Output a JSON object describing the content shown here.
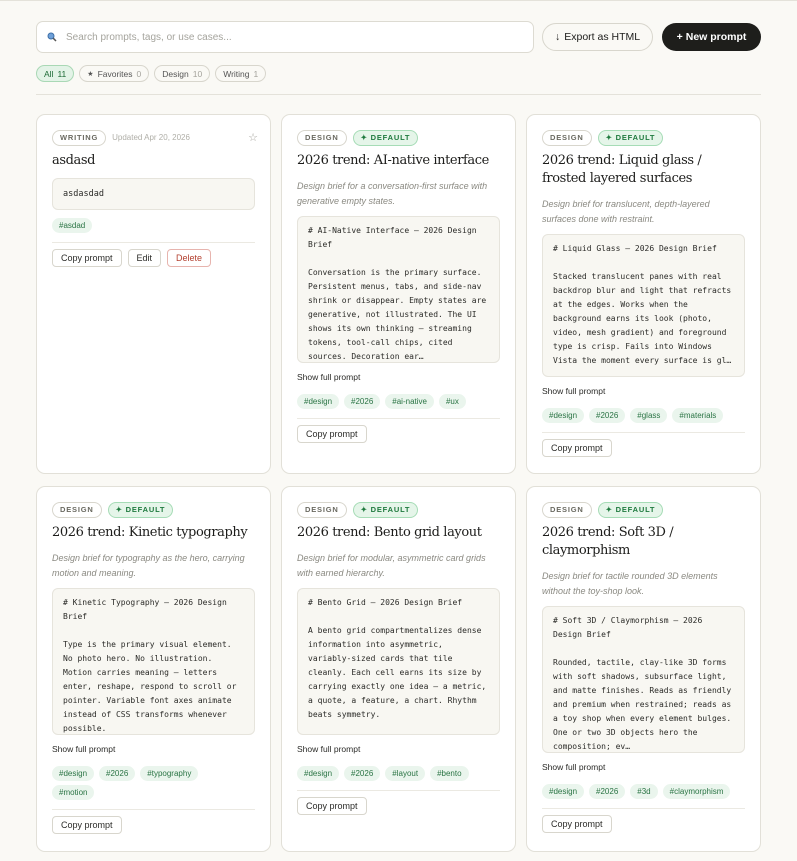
{
  "search": {
    "placeholder": "Search prompts, tags, or use cases..."
  },
  "toolbar": {
    "export_label": "Export as HTML",
    "new_label": "New prompt"
  },
  "filters": [
    {
      "label": "All",
      "count": "11",
      "active": true
    },
    {
      "label": "Favorites",
      "count": "0",
      "active": false
    },
    {
      "label": "Design",
      "count": "10",
      "active": false
    },
    {
      "label": "Writing",
      "count": "1",
      "active": false
    }
  ],
  "cards": [
    {
      "category": "WRITING",
      "updated": "Updated Apr 20, 2026",
      "title": "asdasd",
      "body": "asdasdad",
      "tags": [
        "#asdad"
      ],
      "actions": [
        "Copy prompt",
        "Edit",
        "Delete"
      ]
    },
    {
      "category": "DESIGN",
      "default_label": "DEFAULT",
      "title": "2026 trend: AI-native interface",
      "description": "Design brief for a conversation-first surface with generative empty states.",
      "body": "# AI-Native Interface — 2026 Design Brief\n\nConversation is the primary surface. Persistent menus, tabs, and side-nav shrink or disappear. Empty states are generative, not illustrated. The UI shows its own thinking — streaming tokens, tool-call chips, cited sources. Decoration ear…",
      "show_full": "Show full prompt",
      "tags": [
        "#design",
        "#2026",
        "#ai-native",
        "#ux"
      ],
      "actions": [
        "Copy prompt"
      ]
    },
    {
      "category": "DESIGN",
      "default_label": "DEFAULT",
      "title": "2026 trend: Liquid glass / frosted layered surfaces",
      "description": "Design brief for translucent, depth-layered surfaces done with restraint.",
      "body": "# Liquid Glass — 2026 Design Brief\n\nStacked translucent panes with real backdrop blur and light that refracts at the edges. Works when the background earns its look (photo, video, mesh gradient) and foreground type is crisp. Fails into Windows Vista the moment every surface is gl…",
      "show_full": "Show full prompt",
      "tags": [
        "#design",
        "#2026",
        "#glass",
        "#materials"
      ],
      "actions": [
        "Copy prompt"
      ]
    },
    {
      "category": "DESIGN",
      "default_label": "DEFAULT",
      "title": "2026 trend: Kinetic typography",
      "description": "Design brief for typography as the hero, carrying motion and meaning.",
      "body": "# Kinetic Typography — 2026 Design Brief\n\nType is the primary visual element. No photo hero. No illustration. Motion carries meaning — letters enter, reshape, respond to scroll or pointer. Variable font axes animate instead of CSS transforms whenever possible.",
      "show_full": "Show full prompt",
      "tags": [
        "#design",
        "#2026",
        "#typography",
        "#motion"
      ],
      "actions": [
        "Copy prompt"
      ]
    },
    {
      "category": "DESIGN",
      "default_label": "DEFAULT",
      "title": "2026 trend: Bento grid layout",
      "description": "Design brief for modular, asymmetric card grids with earned hierarchy.",
      "body": "# Bento Grid — 2026 Design Brief\n\nA bento grid compartmentalizes dense information into asymmetric, variably-sized cards that tile cleanly. Each cell earns its size by carrying exactly one idea — a metric, a quote, a feature, a chart. Rhythm beats symmetry.",
      "show_full": "Show full prompt",
      "tags": [
        "#design",
        "#2026",
        "#layout",
        "#bento"
      ],
      "actions": [
        "Copy prompt"
      ]
    },
    {
      "category": "DESIGN",
      "default_label": "DEFAULT",
      "title": "2026 trend: Soft 3D / claymorphism",
      "description": "Design brief for tactile rounded 3D elements without the toy-shop look.",
      "body": "# Soft 3D / Claymorphism — 2026 Design Brief\n\nRounded, tactile, clay-like 3D forms with soft shadows, subsurface light, and matte finishes. Reads as friendly and premium when restrained; reads as a toy shop when every element bulges. One or two 3D objects hero the composition; ev…",
      "show_full": "Show full prompt",
      "tags": [
        "#design",
        "#2026",
        "#3d",
        "#claymorphism"
      ],
      "actions": [
        "Copy prompt"
      ]
    }
  ]
}
